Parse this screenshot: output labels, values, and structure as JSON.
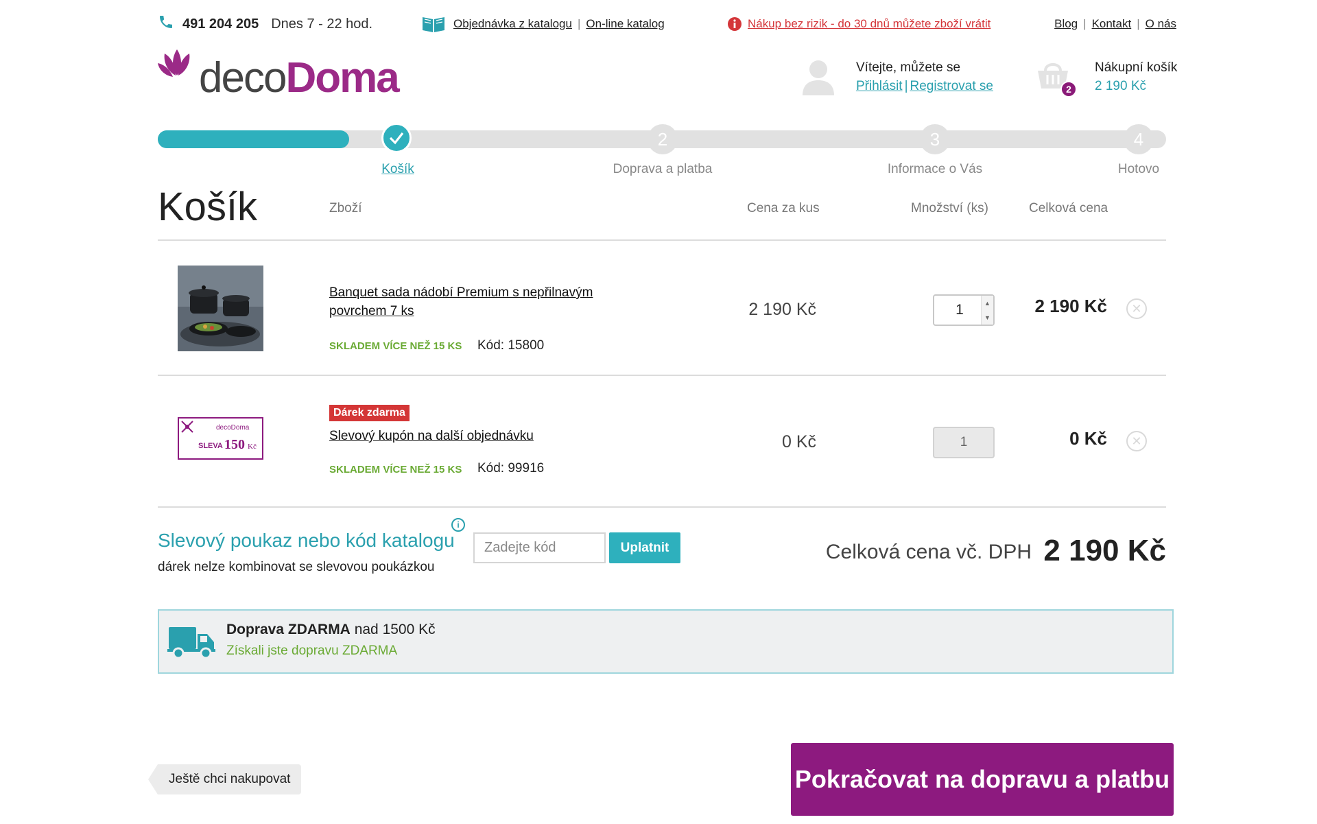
{
  "topbar": {
    "phone": "491 204 205",
    "hours": "Dnes 7 - 22 hod.",
    "catalog_order": "Objednávka z katalogu",
    "online_catalog": "On-line katalog",
    "no_risk": "Nákup bez rizik - do 30 dnů můžete zboží vrátit",
    "links": {
      "blog": "Blog",
      "contact": "Kontakt",
      "about": "O nás"
    }
  },
  "logo": {
    "part1": "deco",
    "part2": "Doma"
  },
  "account": {
    "welcome": "Vítejte, můžete se",
    "login": "Přihlásit",
    "register": "Registrovat se"
  },
  "mini_cart": {
    "title": "Nákupní košík",
    "total": "2 190 Kč",
    "count": "2"
  },
  "steps": [
    {
      "number": "1",
      "label": "Košík",
      "state": "done"
    },
    {
      "number": "2",
      "label": "Doprava a platba",
      "state": "pending"
    },
    {
      "number": "3",
      "label": "Informace o Vás",
      "state": "pending"
    },
    {
      "number": "4",
      "label": "Hotovo",
      "state": "pending"
    }
  ],
  "progress": {
    "completed_fraction": 0.19
  },
  "cart": {
    "title": "Košík",
    "headers": {
      "product": "Zboží",
      "unit_price": "Cena za kus",
      "quantity": "Množství (ks)",
      "total": "Celková cena"
    },
    "items": [
      {
        "name": "Banquet sada nádobí Premium s nepřilnavým povrchem 7 ks",
        "stock": "SKLADEM VÍCE NEŽ 15 KS",
        "code": "Kód: 15800",
        "unit_price": "2 190 Kč",
        "quantity": "1",
        "total": "2 190 Kč"
      },
      {
        "badge": "Dárek zdarma",
        "name": "Slevový kupón na další objednávku",
        "stock": "SKLADEM VÍCE NEŽ 15 KS",
        "code": "Kód: 99916",
        "unit_price": "0 Kč",
        "quantity": "1",
        "total": "0 Kč",
        "coupon_image": {
          "brand": "decoDoma",
          "word": "SLEVA",
          "amount": "150",
          "currency": "Kč"
        }
      }
    ]
  },
  "coupon": {
    "title": "Slevový poukaz nebo kód katalogu",
    "note": "dárek nelze kombinovat se slevovou poukázkou",
    "placeholder": "Zadejte kód",
    "apply": "Uplatnit"
  },
  "summary": {
    "label": "Celková cena vč. DPH",
    "total": "2 190 Kč"
  },
  "shipping": {
    "title_bold": "Doprava ZDARMA",
    "title_rest": " nad 1500 Kč",
    "status": "Získali jste dopravu ZDARMA"
  },
  "actions": {
    "back": "Ještě chci nakupovat",
    "continue": "Pokračovat na dopravu a platbu"
  },
  "colors": {
    "accent": "#2eb0bd",
    "brand": "#8d1a7f",
    "alert": "#d4363a",
    "stock": "#6aaa34"
  },
  "icons": [
    "phone-icon",
    "book-icon",
    "info-icon",
    "user-icon",
    "basket-icon",
    "check-icon",
    "close-icon",
    "truck-icon"
  ]
}
